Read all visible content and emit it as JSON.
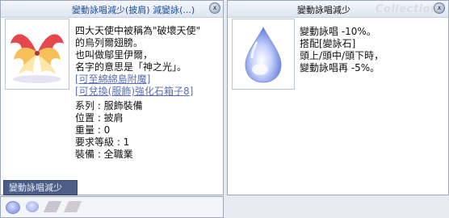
{
  "left": {
    "title": "變動詠唱減少(披肩) 減變詠(...)",
    "lines": [
      "四大天使中被稱為\"破壞天使\"",
      "的烏列爾翅膀。",
      "也叫做鄔里伊爾，",
      "名字的意思是「神之光」。"
    ],
    "links": [
      "[可至綿綿島附魔]",
      "[可兌換(服飾)強化石箱子8]"
    ],
    "props": [
      "系列 : 服飾裝備",
      "位置 : 披肩",
      "重量 : 0",
      "要求等級 : 1",
      "裝備 : 全職業"
    ],
    "tab_label": "變動詠唱減少"
  },
  "right": {
    "title": "變動詠唱減少",
    "watermark": "Collections",
    "lines": [
      "變動詠唱 -10%。",
      "搭配[變詠石]",
      " 頭上/頭中/頭下時，",
      "變動詠唱再 -5%。"
    ]
  },
  "close_glyph": "x"
}
